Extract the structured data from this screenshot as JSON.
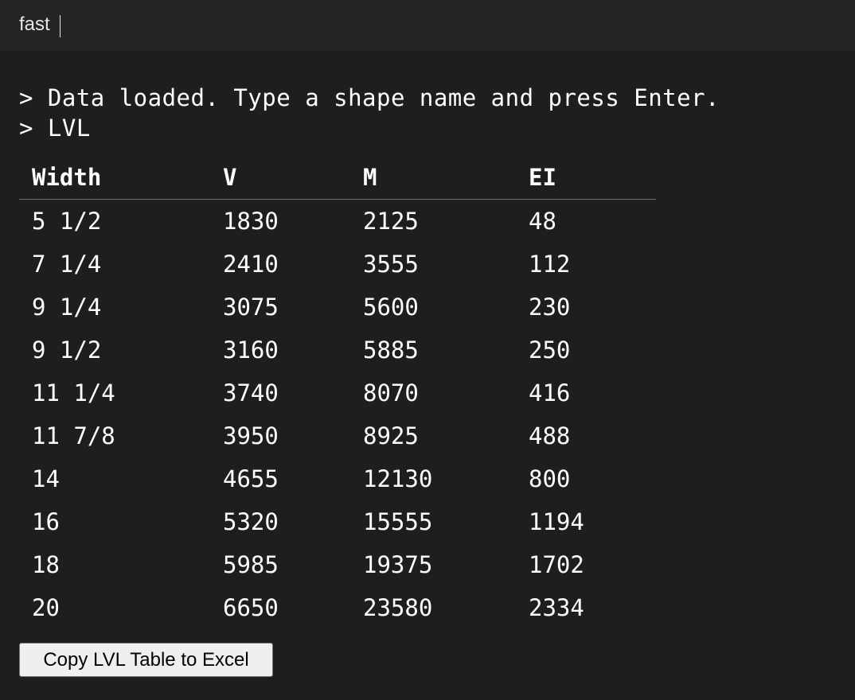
{
  "input": {
    "value": "fast"
  },
  "console": {
    "lines": [
      "> Data loaded. Type a shape name and press Enter.",
      "> LVL"
    ]
  },
  "table": {
    "headers": [
      "Width",
      "V",
      "M",
      "EI"
    ],
    "rows": [
      [
        "5 1/2",
        "1830",
        "2125",
        "48"
      ],
      [
        "7 1/4",
        "2410",
        "3555",
        "112"
      ],
      [
        "9 1/4",
        "3075",
        "5600",
        "230"
      ],
      [
        "9 1/2",
        "3160",
        "5885",
        "250"
      ],
      [
        "11 1/4",
        "3740",
        "8070",
        "416"
      ],
      [
        "11 7/8",
        "3950",
        "8925",
        "488"
      ],
      [
        "14",
        "4655",
        "12130",
        "800"
      ],
      [
        "16",
        "5320",
        "15555",
        "1194"
      ],
      [
        "18",
        "5985",
        "19375",
        "1702"
      ],
      [
        "20",
        "6650",
        "23580",
        "2334"
      ]
    ]
  },
  "copy_button": {
    "label": "Copy LVL Table to Excel"
  }
}
